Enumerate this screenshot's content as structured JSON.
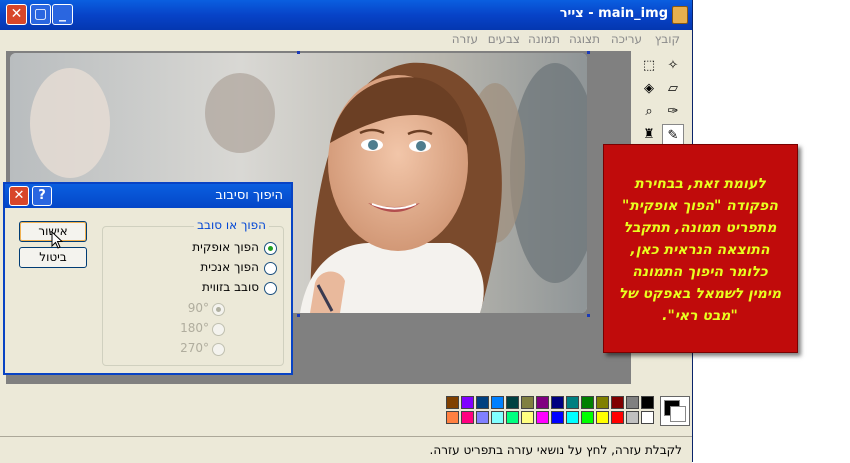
{
  "window": {
    "title": "main_img - צייר",
    "close_glyph": "✕",
    "max_glyph": "▢",
    "min_glyph": "_"
  },
  "menu": [
    "קובץ",
    "עריכה",
    "תצוגה",
    "תמונה",
    "צבעים",
    "עזרה"
  ],
  "dialog": {
    "title": "היפוך וסיבוב",
    "help_glyph": "?",
    "close_glyph": "✕",
    "ok_label": "אישור",
    "cancel_label": "ביטול",
    "group_label": "הפוך או סובב",
    "options": [
      {
        "label": "הפוך אופקית",
        "checked": true
      },
      {
        "label": "הפוך אנכית",
        "checked": false
      },
      {
        "label": "סובב בזווית",
        "checked": false
      }
    ],
    "angles": [
      {
        "label": "90°",
        "checked": true
      },
      {
        "label": "180°",
        "checked": false
      },
      {
        "label": "270°",
        "checked": false
      }
    ]
  },
  "status_text": "לקבלת עזרה, לחץ על נושאי עזרה בתפריט עזרה.",
  "callout": {
    "lines": [
      "לעומת זאת, בבחירת",
      "הפקודה \"הפוך אופקית\"",
      "מתפריט תמונה, תתקבל",
      "התוצאה הנראית כאן,",
      "כלומר היפוך התמונה",
      "מימין לשמאל באפקט של",
      "\"מבט ראי\"."
    ],
    "bg_color": "#c00b0b",
    "text_color": "#e8ff20"
  },
  "palette": {
    "top_row": [
      "#000000",
      "#808080",
      "#800000",
      "#808000",
      "#008000",
      "#008080",
      "#000080",
      "#800080",
      "#808040",
      "#004040",
      "#0080ff",
      "#004080",
      "#8000ff",
      "#804000"
    ],
    "bottom_row": [
      "#ffffff",
      "#c0c0c0",
      "#ff0000",
      "#ffff00",
      "#00ff00",
      "#00ffff",
      "#0000ff",
      "#ff00ff",
      "#ffff80",
      "#00ff80",
      "#80ffff",
      "#8080ff",
      "#ff0080",
      "#ff8040"
    ]
  },
  "tools": [
    {
      "name": "free-select-icon",
      "glyph": "✧"
    },
    {
      "name": "rect-select-icon",
      "glyph": "⬚"
    },
    {
      "name": "eraser-icon",
      "glyph": "▱"
    },
    {
      "name": "fill-icon",
      "glyph": "◈"
    },
    {
      "name": "color-picker-icon",
      "glyph": "✑"
    },
    {
      "name": "magnifier-icon",
      "glyph": "⌕"
    },
    {
      "name": "pencil-icon",
      "glyph": "✎"
    },
    {
      "name": "brush-icon",
      "glyph": "♜"
    }
  ]
}
